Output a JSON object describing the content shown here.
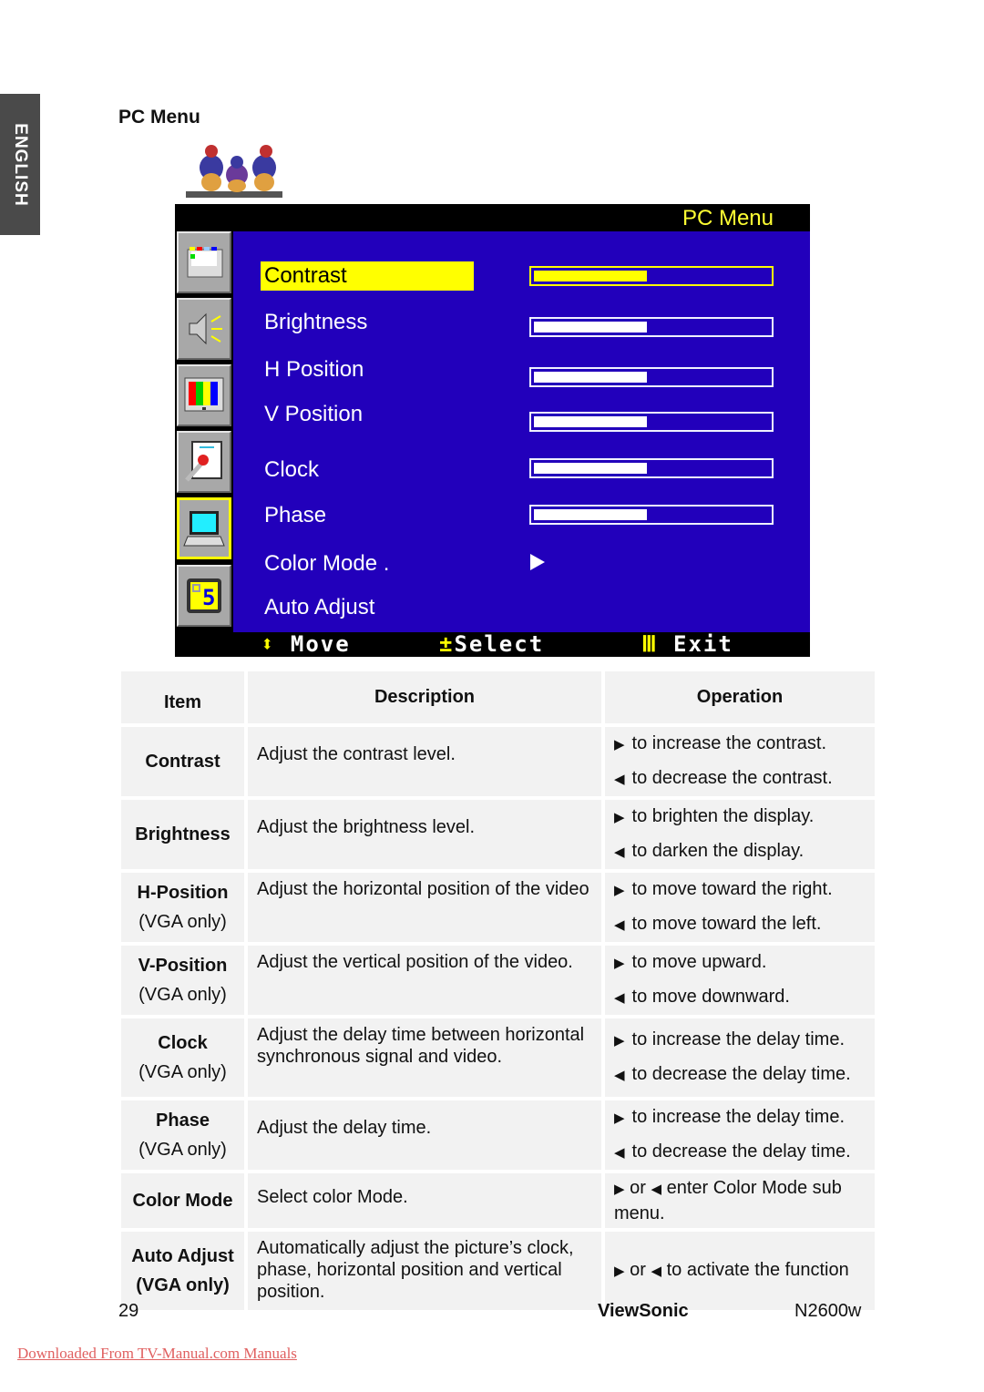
{
  "sidebar": {
    "language_tab": "ENGLISH"
  },
  "section": {
    "title": "PC Menu"
  },
  "osd": {
    "header_title": "PC Menu",
    "icons": [
      {
        "name": "picture-adjust-icon"
      },
      {
        "name": "audio-speaker-icon"
      },
      {
        "name": "color-bars-icon"
      },
      {
        "name": "setup-wrench-icon"
      },
      {
        "name": "pc-laptop-icon",
        "active": true
      },
      {
        "name": "osd-settings-icon"
      }
    ],
    "items": [
      {
        "label": "Contrast",
        "selected": true,
        "value_percent": 48
      },
      {
        "label": "Brightness",
        "value_percent": 48
      },
      {
        "label": "H Position",
        "value_percent": 48
      },
      {
        "label": "V Position",
        "value_percent": 48
      },
      {
        "label": "Clock",
        "value_percent": 48
      },
      {
        "label": "Phase",
        "value_percent": 48
      },
      {
        "label": "Color Mode .",
        "submenu": true
      },
      {
        "label": "Auto Adjust"
      }
    ],
    "footer": {
      "move_label": "Move",
      "select_label": "Select",
      "exit_label": "Exit",
      "move_icon": "⬍",
      "select_icon": "±",
      "exit_icon": "Ⅲ"
    },
    "colors": {
      "background": "#2200bb",
      "highlight": "#ffff00",
      "header": "#000000"
    }
  },
  "table": {
    "headers": {
      "item": "Item",
      "description": "Description",
      "operation": "Operation"
    },
    "rows": [
      {
        "item": "Contrast",
        "sub": "",
        "description": "Adjust the contrast level.",
        "op_right": "to increase the contrast.",
        "op_left": "to decrease the contrast."
      },
      {
        "item": "Brightness",
        "sub": "",
        "description": "Adjust the brightness level.",
        "op_right": "to brighten the display.",
        "op_left": "to darken the display."
      },
      {
        "item": "H-Position",
        "sub": "(VGA only)",
        "description": "Adjust the horizontal position of the video",
        "op_right": "to move toward the right.",
        "op_left": "to move toward the left."
      },
      {
        "item": "V-Position",
        "sub": "(VGA only)",
        "description": "Adjust the vertical position of the video.",
        "op_right": "to move upward.",
        "op_left": "to move downward."
      },
      {
        "item": "Clock",
        "sub": "(VGA only)",
        "description": "Adjust the delay time between horizontal synchronous signal and video.",
        "op_right": "to increase the delay time.",
        "op_left": "to decrease the delay time."
      },
      {
        "item": "Phase",
        "sub": "(VGA only)",
        "description": "Adjust the delay time.",
        "op_right": "to increase the delay time.",
        "op_left": "to decrease the delay time."
      },
      {
        "item": "Color Mode",
        "sub": "",
        "description": "Select color Mode.",
        "op_combined": "or",
        "op_text": "enter Color Mode sub menu."
      },
      {
        "item": "Auto Adjust",
        "sub": "(VGA only)",
        "description": "Automatically adjust the picture’s clock, phase, horizontal position and vertical position.",
        "op_combined": "or",
        "op_text": "to activate the function"
      }
    ]
  },
  "footer": {
    "page_number": "29",
    "brand": "ViewSonic",
    "model": "N2600w",
    "download_link": "Downloaded From TV-Manual.com Manuals"
  }
}
